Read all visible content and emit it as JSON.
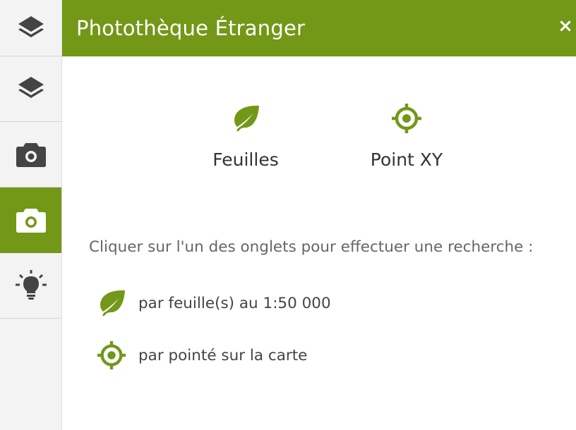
{
  "sidebar": {
    "items": [
      {
        "name": "layers",
        "icon": "layers-icon",
        "active": false
      },
      {
        "name": "layers-2",
        "icon": "layers-icon",
        "active": false
      },
      {
        "name": "camera",
        "icon": "camera-icon",
        "active": false
      },
      {
        "name": "camera-active",
        "icon": "camera-icon",
        "active": true
      },
      {
        "name": "bulb",
        "icon": "lightbulb-icon",
        "active": false
      }
    ]
  },
  "header": {
    "title": "Photothèque Étranger",
    "close_label": "×"
  },
  "tabs": [
    {
      "label": "Feuilles",
      "icon": "leaf-icon"
    },
    {
      "label": "Point XY",
      "icon": "target-icon"
    }
  ],
  "instructions": "Cliquer sur l'un des onglets pour effectuer une recherche :",
  "hints": [
    {
      "icon": "leaf-icon",
      "text": "par feuille(s) au 1:50 000"
    },
    {
      "icon": "target-icon",
      "text": "par pointé sur la carte"
    }
  ],
  "colors": {
    "accent": "#739717",
    "sidebar_bg": "#f3f3f3",
    "icon_dark": "#444444",
    "text": "#333333",
    "muted_text": "#666666"
  }
}
